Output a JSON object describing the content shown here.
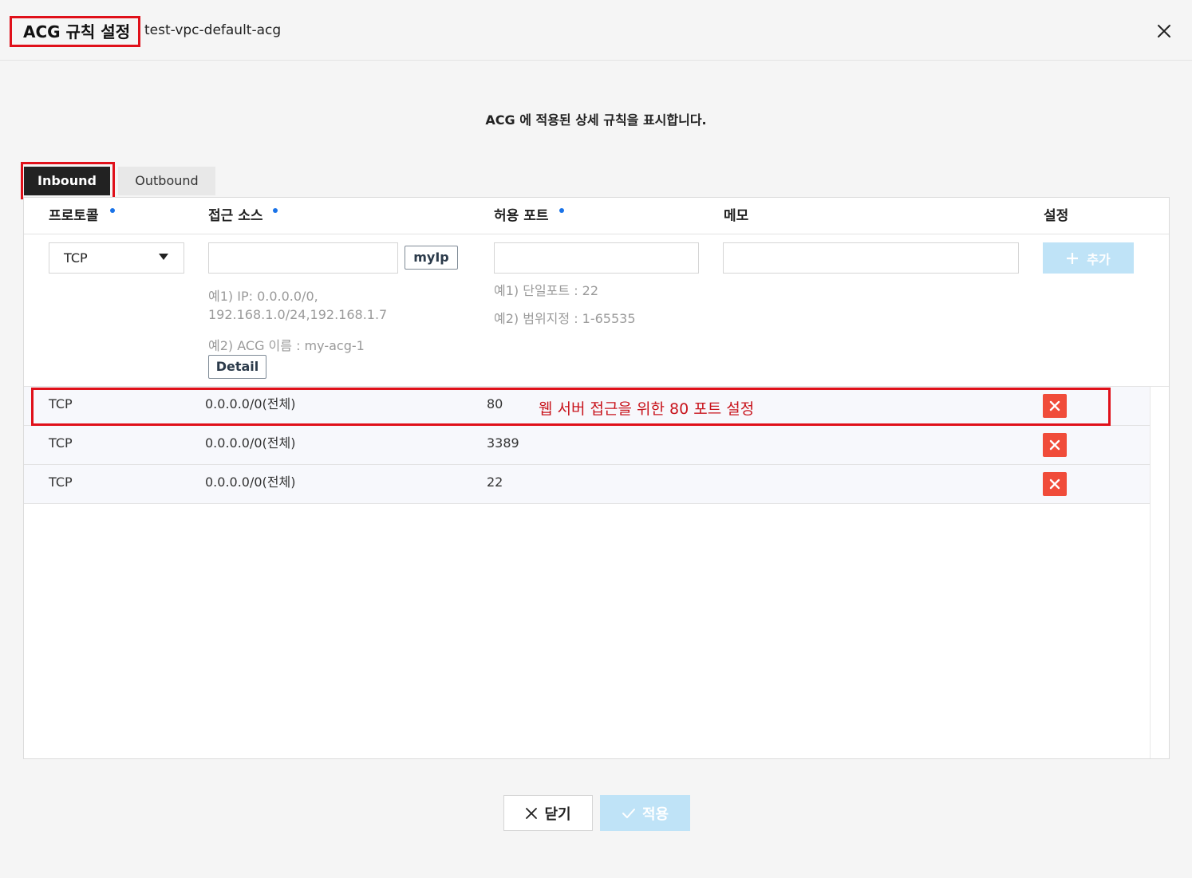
{
  "header": {
    "title": "ACG 규칙 설정",
    "subtitle": "test-vpc-default-acg"
  },
  "description": "ACG 에 적용된 상세 규칙을 표시합니다.",
  "tabs": [
    {
      "label": "Inbound",
      "active": true
    },
    {
      "label": "Outbound",
      "active": false
    }
  ],
  "columns": {
    "protocol": "프로토콜",
    "source": "접근 소스",
    "port": "허용 포트",
    "memo": "메모",
    "settings": "설정"
  },
  "form": {
    "protocol_value": "TCP",
    "myip_label": "myIp",
    "source_hint_1a": "예1) IP: 0.0.0.0/0,",
    "source_hint_1b": "192.168.1.0/24,192.168.1.7",
    "source_hint_2": "예2) ACG 이름 : my-acg-1",
    "detail_label": "Detail",
    "port_hint_1": "예1) 단일포트 : 22",
    "port_hint_2": "예2) 범위지정 : 1-65535",
    "add_label": "추가"
  },
  "rules": [
    {
      "protocol": "TCP",
      "source": "0.0.0.0/0(전체)",
      "port": "80",
      "memo": ""
    },
    {
      "protocol": "TCP",
      "source": "0.0.0.0/0(전체)",
      "port": "3389",
      "memo": ""
    },
    {
      "protocol": "TCP",
      "source": "0.0.0.0/0(전체)",
      "port": "22",
      "memo": ""
    }
  ],
  "annotation": "웹 서버 접근을 위한 80 포트 설정",
  "footer": {
    "close_label": "닫기",
    "apply_label": "적용"
  },
  "colors": {
    "highlight": "#e0101a",
    "delete": "#f04c3a",
    "primary_disabled": "#bfe3f7",
    "required_dot": "#1a73e8"
  }
}
